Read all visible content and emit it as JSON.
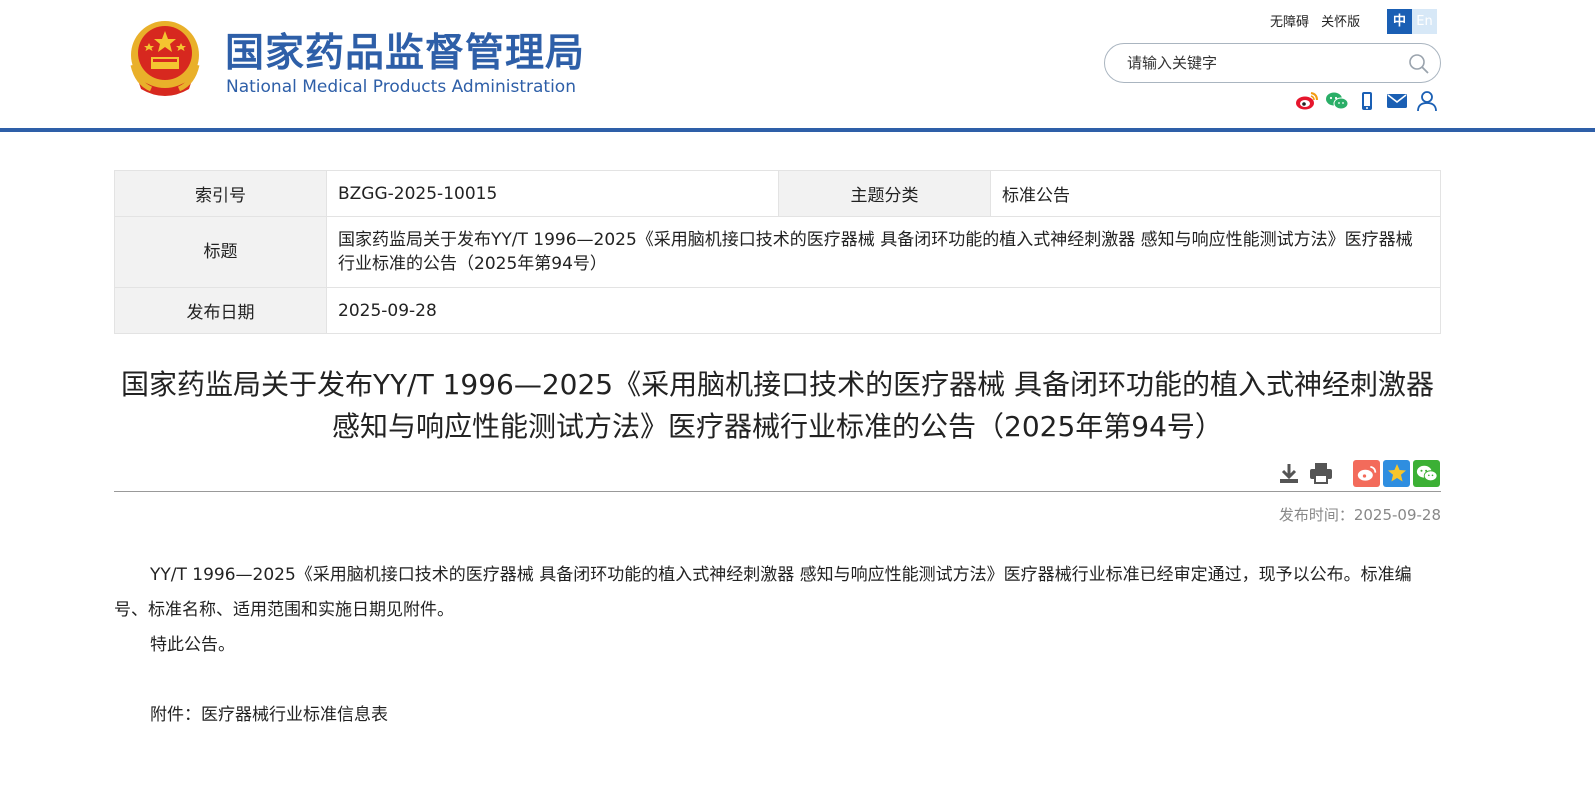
{
  "header": {
    "title_cn": "国家药品监督管理局",
    "title_en": "National Medical Products Administration",
    "top_links": [
      "无障碍",
      "关怀版"
    ],
    "lang_zh": "中",
    "lang_en": "En",
    "search_placeholder": "请输入关键字",
    "social_icons": [
      "weibo-icon",
      "wechat-icon",
      "mobile-icon",
      "mail-icon",
      "user-icon"
    ]
  },
  "info": {
    "index_label": "索引号",
    "index_value": "BZGG-2025-10015",
    "topic_label": "主题分类",
    "topic_value": "标准公告",
    "title_label": "标题",
    "title_value": "国家药监局关于发布YY/T 1996—2025《采用脑机接口技术的医疗器械 具备闭环功能的植入式神经刺激器 感知与响应性能测试方法》医疗器械行业标准的公告（2025年第94号）",
    "date_label": "发布日期",
    "date_value": "2025-09-28"
  },
  "article": {
    "title": "国家药监局关于发布YY/T 1996—2025《采用脑机接口技术的医疗器械 具备闭环功能的植入式神经刺激器 感知与响应性能测试方法》医疗器械行业标准的公告（2025年第94号）",
    "pubtime": "发布时间：2025-09-28",
    "para1": "YY/T 1996—2025《采用脑机接口技术的医疗器械 具备闭环功能的植入式神经刺激器 感知与响应性能测试方法》医疗器械行业标准已经审定通过，现予以公布。标准编号、标准名称、适用范围和实施日期见附件。",
    "para2": "特此公告。",
    "attachment": "附件：医疗器械行业标准信息表"
  },
  "colors": {
    "brand_blue": "#2e5fa8",
    "lang_active": "#1a5fb4",
    "weibo_share": "#f36b5b",
    "favorite_share": "#2f8ee0",
    "wechat_share": "#3cb035"
  }
}
